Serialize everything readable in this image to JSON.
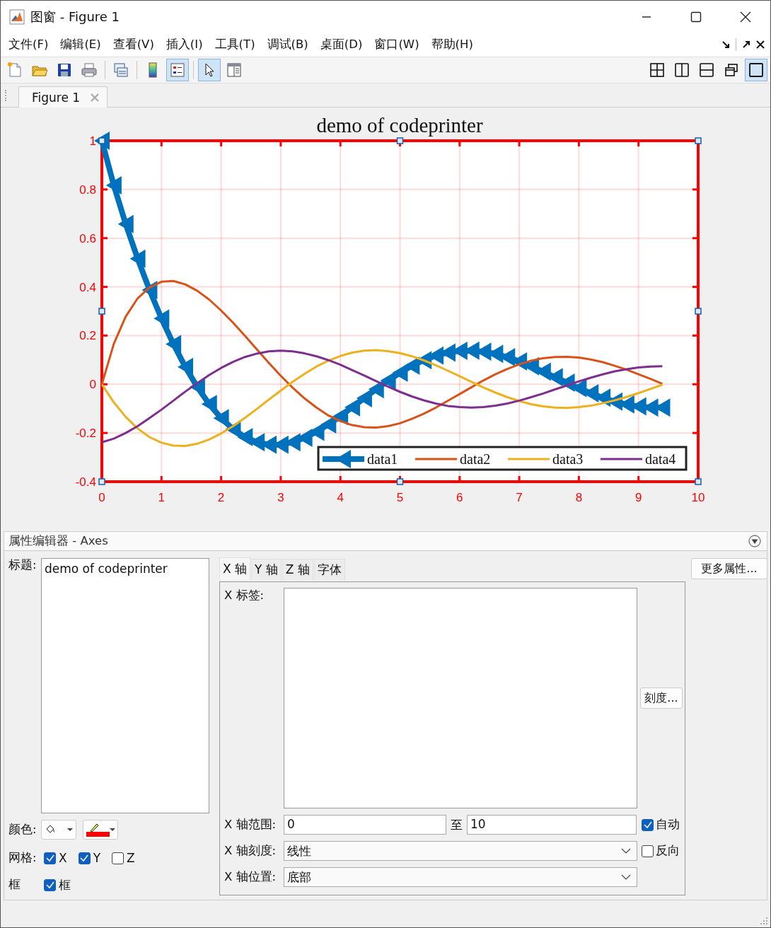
{
  "window": {
    "title": "图窗 - Figure 1"
  },
  "menu": [
    {
      "label": "文件(F)"
    },
    {
      "label": "编辑(E)"
    },
    {
      "label": "查看(V)"
    },
    {
      "label": "插入(I)"
    },
    {
      "label": "工具(T)"
    },
    {
      "label": "调试(B)"
    },
    {
      "label": "桌面(D)"
    },
    {
      "label": "窗口(W)"
    },
    {
      "label": "帮助(H)"
    }
  ],
  "toolbar": {
    "groups": [
      [
        {
          "kind": "new",
          "selected": false
        },
        {
          "kind": "open",
          "selected": false
        },
        {
          "kind": "save",
          "selected": false
        },
        {
          "kind": "print",
          "selected": false
        }
      ],
      [
        {
          "kind": "link",
          "selected": false
        }
      ],
      [
        {
          "kind": "colorbar",
          "selected": false
        },
        {
          "kind": "legend",
          "selected": true
        }
      ],
      [
        {
          "kind": "pointer",
          "selected": true
        },
        {
          "kind": "inspector",
          "selected": false
        }
      ]
    ],
    "right": [
      {
        "kind": "grid4",
        "selected": false
      },
      {
        "kind": "cols2",
        "selected": false
      },
      {
        "kind": "rows2",
        "selected": false
      },
      {
        "kind": "float",
        "selected": false
      },
      {
        "kind": "single",
        "selected": true
      }
    ]
  },
  "tabs": [
    {
      "label": "Figure 1",
      "selected": true
    }
  ],
  "figure": {
    "chart_data": {
      "type": "line",
      "title": "demo of codeprinter",
      "x": [
        0,
        0.2,
        0.4,
        0.6,
        0.8,
        1,
        1.2,
        1.4,
        1.6,
        1.8,
        2,
        2.2,
        2.4,
        2.6,
        2.8,
        3,
        3.2,
        3.4,
        3.6,
        3.8,
        4,
        4.2,
        4.4,
        4.6,
        4.8,
        5,
        5.2,
        5.4,
        5.6,
        5.8,
        6,
        6.2,
        6.4,
        6.6,
        6.8,
        7,
        7.2,
        7.4,
        7.6,
        7.8,
        8,
        8.2,
        8.4,
        8.6,
        8.8,
        9,
        9.2,
        9.4
      ],
      "series": [
        {
          "name": "data1",
          "color": "#0072bd",
          "marker": "triangle-left",
          "values": [
            1,
            0.817,
            0.658,
            0.516,
            0.387,
            0.27,
            0.165,
            0.071,
            -0.011,
            -0.081,
            -0.139,
            -0.184,
            -0.217,
            -0.238,
            -0.248,
            -0.248,
            -0.238,
            -0.22,
            -0.195,
            -0.165,
            -0.131,
            -0.094,
            -0.057,
            -0.02,
            0.015,
            0.047,
            0.076,
            0.099,
            0.118,
            0.13,
            0.137,
            0.138,
            0.134,
            0.125,
            0.111,
            0.094,
            0.074,
            0.052,
            0.029,
            0.007,
            -0.016,
            -0.037,
            -0.055,
            -0.071,
            -0.083,
            -0.091,
            -0.096,
            -0.096
          ]
        },
        {
          "name": "data2",
          "color": "#d95319",
          "values": [
            0,
            0.166,
            0.278,
            0.353,
            0.398,
            0.421,
            0.424,
            0.41,
            0.384,
            0.348,
            0.303,
            0.253,
            0.199,
            0.143,
            0.088,
            0.035,
            -0.014,
            -0.058,
            -0.096,
            -0.128,
            -0.151,
            -0.168,
            -0.176,
            -0.178,
            -0.172,
            -0.16,
            -0.142,
            -0.121,
            -0.096,
            -0.068,
            -0.04,
            -0.012,
            0.016,
            0.041,
            0.063,
            0.082,
            0.097,
            0.107,
            0.112,
            0.113,
            0.11,
            0.102,
            0.091,
            0.076,
            0.06,
            0.041,
            0.022,
            0.002
          ]
        },
        {
          "name": "data3",
          "color": "#edb120",
          "values": [
            0,
            -0.074,
            -0.134,
            -0.182,
            -0.217,
            -0.24,
            -0.252,
            -0.253,
            -0.244,
            -0.227,
            -0.202,
            -0.172,
            -0.138,
            -0.101,
            -0.063,
            -0.026,
            0.01,
            0.043,
            0.073,
            0.097,
            0.116,
            0.13,
            0.138,
            0.14,
            0.136,
            0.128,
            0.115,
            0.098,
            0.078,
            0.056,
            0.033,
            0.01,
            -0.013,
            -0.034,
            -0.053,
            -0.069,
            -0.082,
            -0.091,
            -0.096,
            -0.097,
            -0.094,
            -0.088,
            -0.078,
            -0.066,
            -0.052,
            -0.036,
            -0.019,
            -0.002
          ]
        },
        {
          "name": "data4",
          "color": "#7e2f8e",
          "values": [
            -0.238,
            -0.223,
            -0.2,
            -0.172,
            -0.139,
            -0.104,
            -0.067,
            -0.03,
            0.005,
            0.038,
            0.067,
            0.092,
            0.112,
            0.126,
            0.135,
            0.138,
            0.135,
            0.127,
            0.115,
            0.099,
            0.08,
            0.058,
            0.036,
            0.013,
            -0.01,
            -0.031,
            -0.05,
            -0.066,
            -0.079,
            -0.089,
            -0.094,
            -0.096,
            -0.094,
            -0.088,
            -0.079,
            -0.067,
            -0.053,
            -0.038,
            -0.021,
            -0.005,
            0.012,
            0.027,
            0.041,
            0.053,
            0.062,
            0.069,
            0.073,
            0.074
          ]
        }
      ],
      "xlim": [
        0,
        10
      ],
      "ylim": [
        -0.4,
        1
      ],
      "xticks": [
        0,
        1,
        2,
        3,
        4,
        5,
        6,
        7,
        8,
        9,
        10
      ],
      "yticks": [
        -0.4,
        -0.2,
        0,
        0.2,
        0.4,
        0.6,
        0.8,
        1
      ],
      "grid": true,
      "legend": true
    }
  },
  "property_editor": {
    "title": "属性编辑器 - Axes",
    "title_label": "标题:",
    "title_value": "demo of codeprinter",
    "color_label": "颜色:",
    "color_buttons": [
      {
        "kind": "fill"
      },
      {
        "kind": "edge",
        "color": "#ff0000"
      }
    ],
    "grid_label": "网格:",
    "grid": [
      {
        "label": "X",
        "checked": true
      },
      {
        "label": "Y",
        "checked": true
      },
      {
        "label": "Z",
        "checked": false
      }
    ],
    "box_label": "框",
    "box": {
      "label": "框",
      "checked": true
    },
    "tabs": [
      {
        "label": "X 轴",
        "selected": true
      },
      {
        "label": "Y 轴",
        "selected": false
      },
      {
        "label": "Z 轴",
        "selected": false
      },
      {
        "label": "字体",
        "selected": false
      }
    ],
    "xlabel_label": "X 标签:",
    "ticks_button": "刻度...",
    "range_label": "X 轴范围:",
    "range_from": "0",
    "range_to_label": "至",
    "range_to": "10",
    "auto": {
      "label": "自动",
      "checked": true
    },
    "scale_label": "X 轴刻度:",
    "scale": "线性",
    "reverse": {
      "label": "反向",
      "checked": false
    },
    "location_label": "X 轴位置:",
    "location": "底部",
    "more_button": "更多属性..."
  }
}
